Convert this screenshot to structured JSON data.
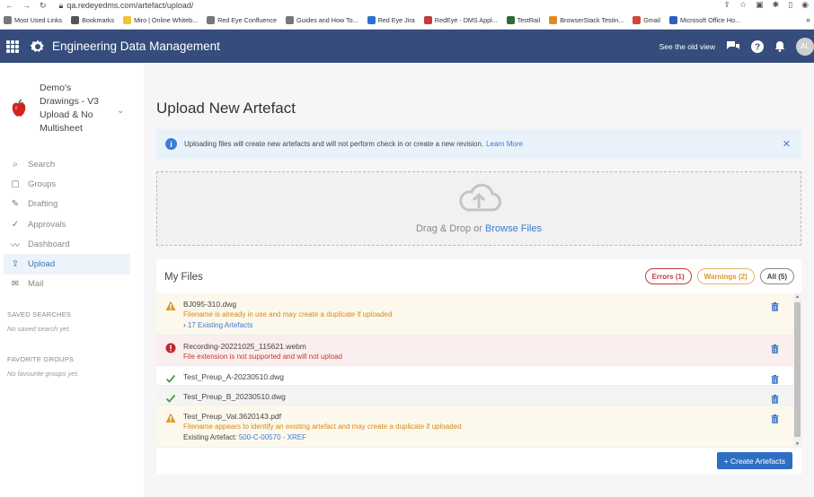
{
  "browser": {
    "url": "qa.redeyedms.com/artefact/upload/",
    "bookmarks": [
      {
        "label": "Most Used Links",
        "color": "#777777"
      },
      {
        "label": "Bookmarks",
        "color": "#555555"
      },
      {
        "label": "Miro | Online Whiteb...",
        "color": "#f2c230"
      },
      {
        "label": "Red Eye Confluence",
        "color": "#777777"
      },
      {
        "label": "Guides and How To...",
        "color": "#777777"
      },
      {
        "label": "Red Eye Jira",
        "color": "#2d6fd0"
      },
      {
        "label": "RedEye - DMS Appl...",
        "color": "#c23a3a"
      },
      {
        "label": "TestRail",
        "color": "#2d6b3a"
      },
      {
        "label": "BrowserStack Testin...",
        "color": "#e08a1e"
      },
      {
        "label": "Gmail",
        "color": "#d44638"
      },
      {
        "label": "Microsoft Office Ho...",
        "color": "#2d5fbf"
      }
    ],
    "more": "»"
  },
  "header": {
    "title": "Engineering Data Management",
    "old_view": "See the old view",
    "avatar": "AL"
  },
  "sidebar": {
    "project_name": "Demo's Drawings - V3 Upload & No Multisheet",
    "nav": [
      {
        "label": "Search",
        "icon": "search-icon",
        "glyph": "⌕"
      },
      {
        "label": "Groups",
        "icon": "folder-icon",
        "glyph": "▢"
      },
      {
        "label": "Drafting",
        "icon": "pencil-icon",
        "glyph": "✎"
      },
      {
        "label": "Approvals",
        "icon": "check-icon",
        "glyph": "✓"
      },
      {
        "label": "Dashboard",
        "icon": "chart-line-icon",
        "glyph": "〰"
      },
      {
        "label": "Upload",
        "icon": "upload-icon",
        "glyph": "⇪"
      },
      {
        "label": "Mail",
        "icon": "mail-icon",
        "glyph": "✉"
      }
    ],
    "saved_title": "SAVED SEARCHES",
    "saved_empty": "No saved search yet.",
    "fav_title": "FAVORITE GROUPS",
    "fav_empty": "No favourite groups yet."
  },
  "main": {
    "title": "Upload New Artefact",
    "info_text": "Uploading files will create new artefacts and will not perform check in or create a new revision.",
    "info_link": "Learn More",
    "dropzone_text": "Drag & Drop or",
    "dropzone_link": "Browse Files",
    "files_title": "My Files",
    "filters": {
      "errors": "Errors (1)",
      "warnings": "Warnings (2)",
      "all": "All (5)"
    },
    "files": [
      {
        "name": "BJ095-310.dwg",
        "status": "warning",
        "message": "Filename is already in use and may create a duplicate if uploaded",
        "sub_link": "17 Existing Artefacts"
      },
      {
        "name": "Recording-20221025_115621.webm",
        "status": "error",
        "message": "File extension is not supported and will not upload"
      },
      {
        "name": "Test_Preup_A-20230510.dwg",
        "status": "ok"
      },
      {
        "name": "Test_Preup_B_20230510.dwg",
        "status": "ok"
      },
      {
        "name": "Test_Preup_Val.3620143.pdf",
        "status": "warning",
        "message": "Filename appears to identify an existing artefact and may create a duplicate if uploaded",
        "sub_label": "Existing Artefact:",
        "sub_link": "500-C-00570 - XREF"
      }
    ],
    "create_button": "+ Create Artefacts"
  }
}
